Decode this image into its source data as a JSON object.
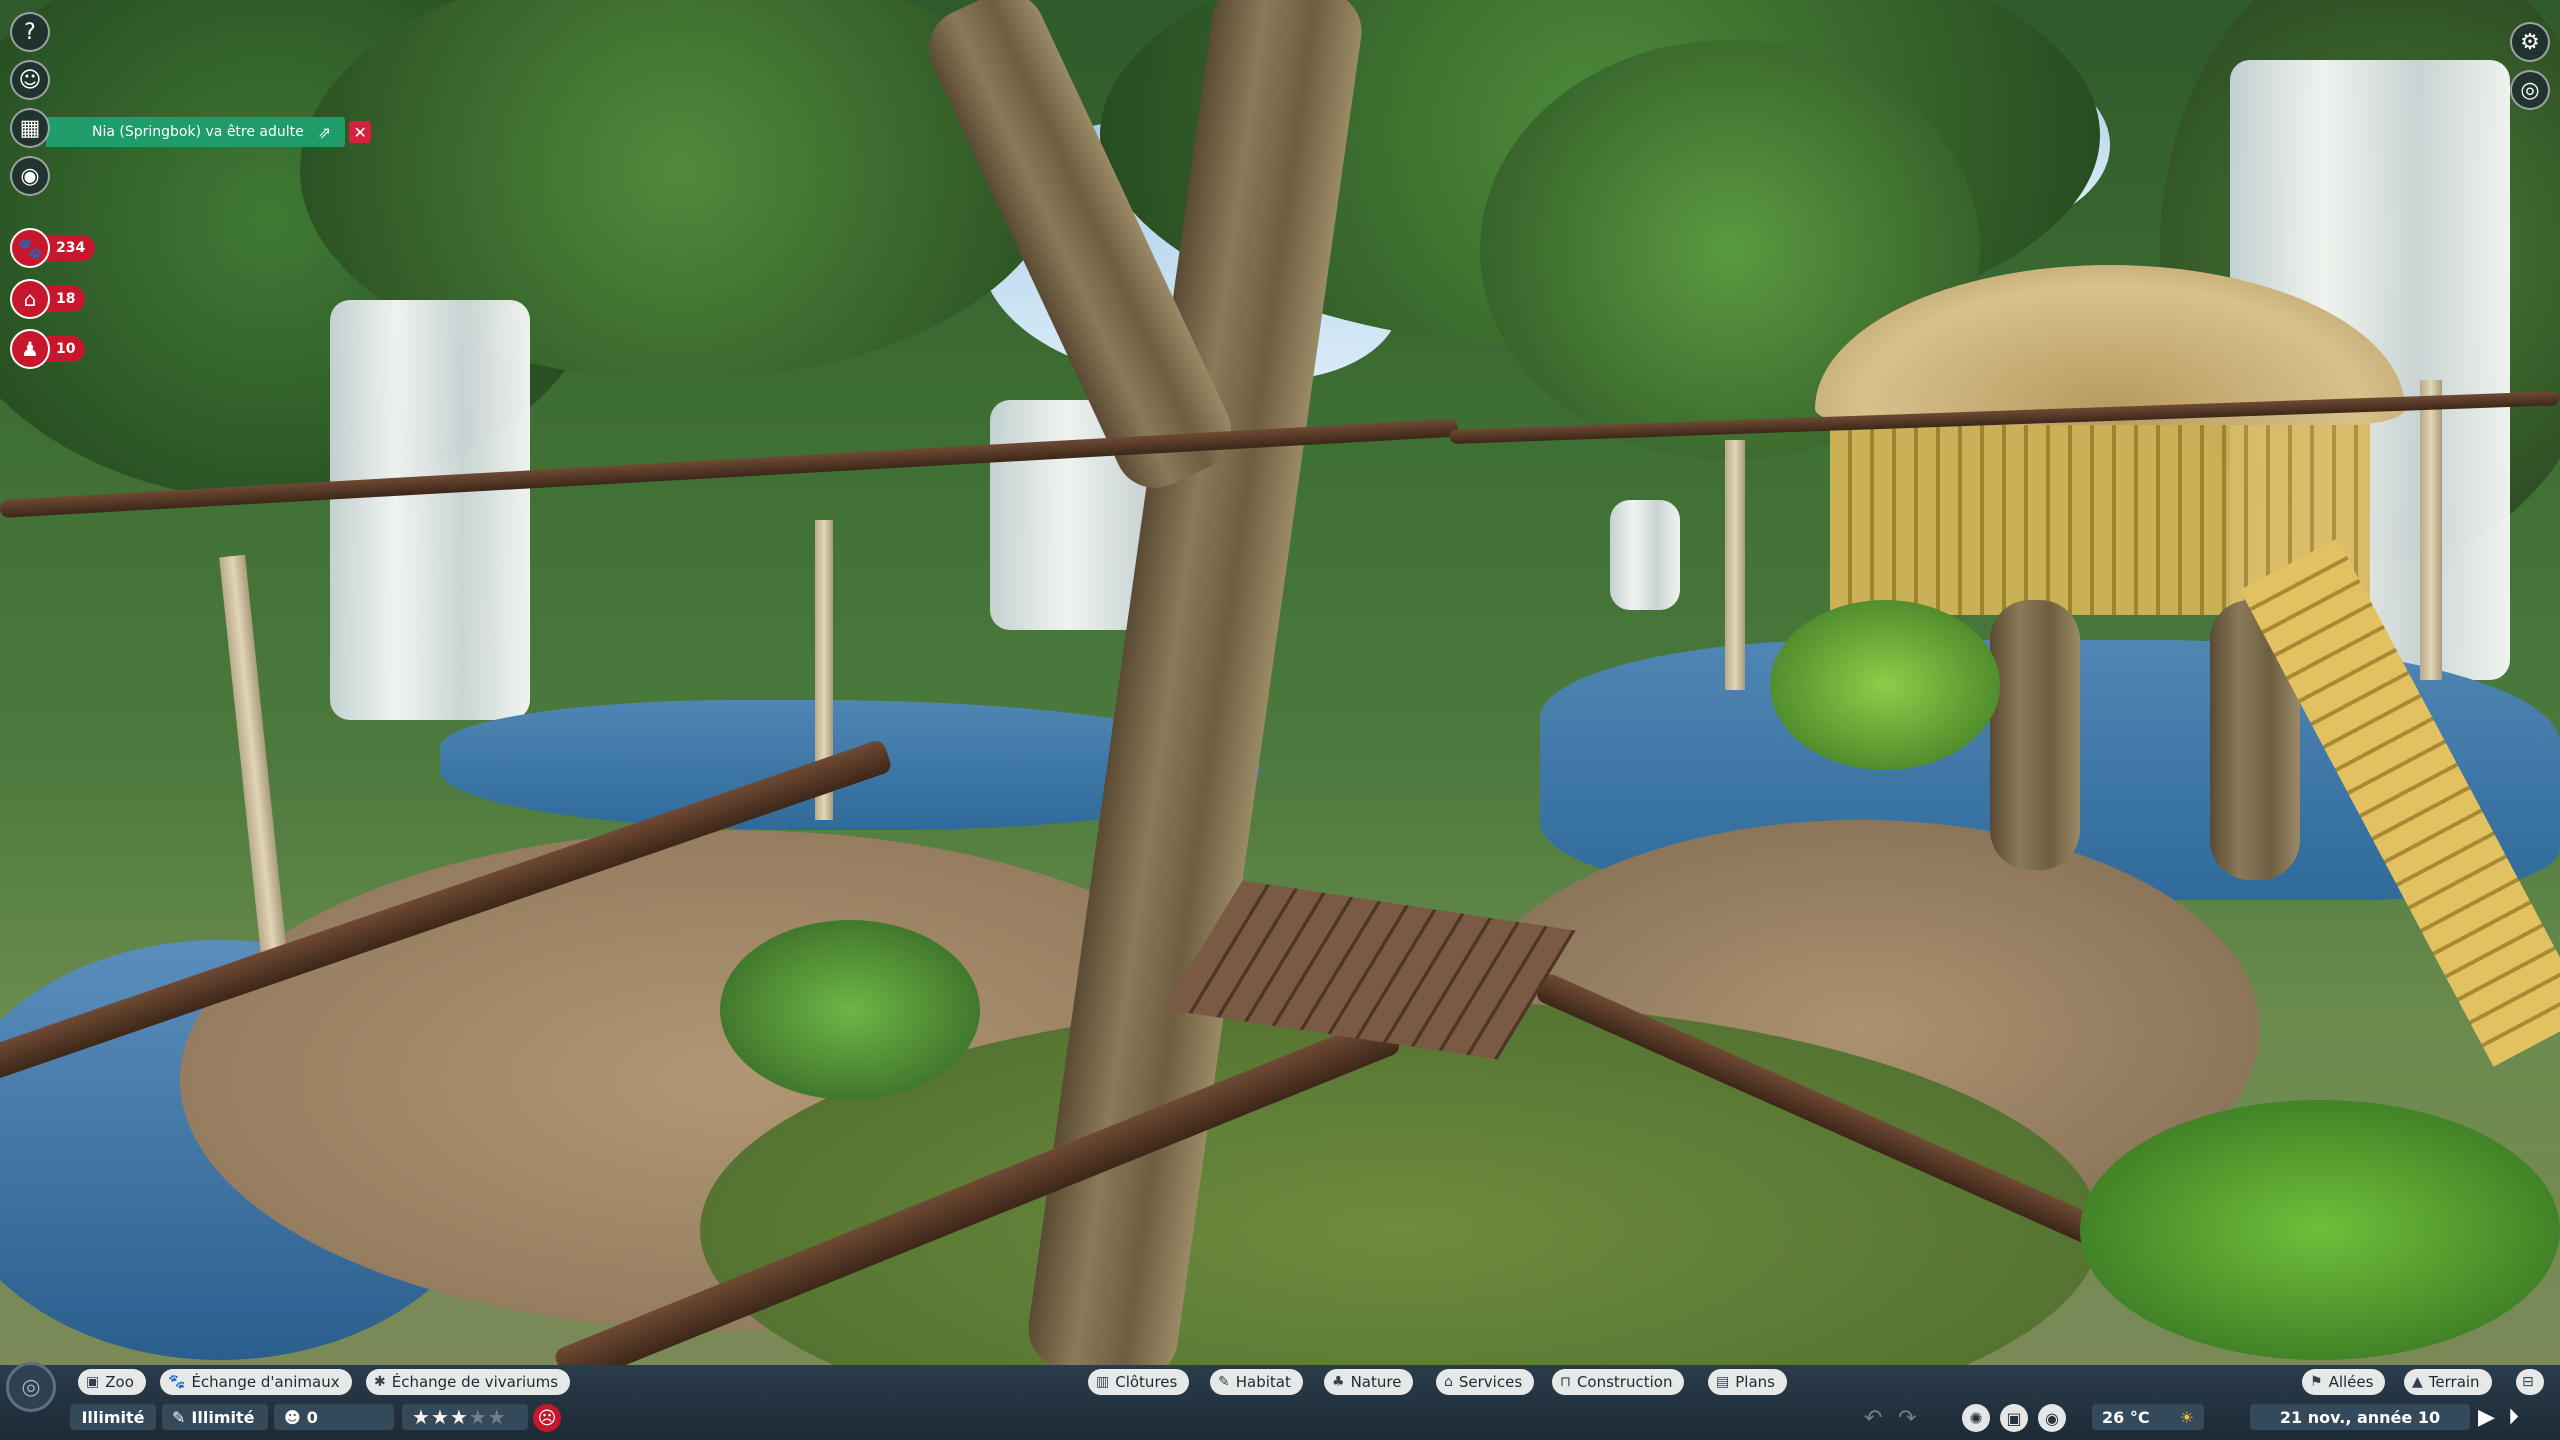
{
  "notification": {
    "text": "Nia (Springbok) va être adulte",
    "open_icon": "external-link-icon",
    "close_label": "✕"
  },
  "left_toolbar": {
    "items": [
      {
        "name": "help-icon",
        "glyph": "?"
      },
      {
        "name": "guest-icon",
        "glyph": "☺"
      },
      {
        "name": "calendar-icon",
        "glyph": "▦"
      },
      {
        "name": "view-icon",
        "glyph": "◉"
      }
    ],
    "counters": [
      {
        "name": "animals-counter",
        "glyph": "🐾",
        "value": "234"
      },
      {
        "name": "habitats-counter",
        "glyph": "⌂",
        "value": "18"
      },
      {
        "name": "staff-counter",
        "glyph": "♟",
        "value": "10"
      }
    ]
  },
  "right_toolbar": {
    "items": [
      {
        "name": "settings-icon",
        "glyph": "⚙"
      },
      {
        "name": "camera-mode-icon",
        "glyph": "◎"
      }
    ]
  },
  "bottom_bar": {
    "left_tabs": [
      {
        "label": "Zoo",
        "icon": "▣"
      },
      {
        "label": "Échange d'animaux",
        "icon": "🐾"
      },
      {
        "label": "Échange de vivariums",
        "icon": "✱"
      }
    ],
    "center_tabs": [
      {
        "label": "Clôtures",
        "icon": "▥"
      },
      {
        "label": "Habitat",
        "icon": "✎"
      },
      {
        "label": "Nature",
        "icon": "♣"
      },
      {
        "label": "Services",
        "icon": "⌂"
      },
      {
        "label": "Construction",
        "icon": "⊓"
      },
      {
        "label": "Plans",
        "icon": "▤"
      }
    ],
    "right_tabs": [
      {
        "label": "Allées",
        "icon": "⚑"
      },
      {
        "label": "Terrain",
        "icon": "▲"
      }
    ],
    "stats": {
      "money": "Illimité",
      "research": "Illimité",
      "research_icon": "✎",
      "guests": "0",
      "guests_icon": "☻",
      "rating_stars": 3,
      "rating_max": 5,
      "temperature": "26 °C",
      "weather_icon": "sun-icon",
      "date": "21 nov., année 10"
    }
  }
}
